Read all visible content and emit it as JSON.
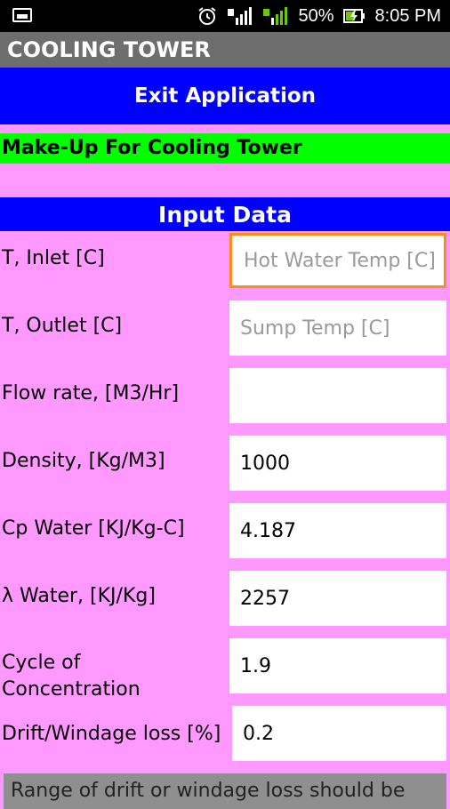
{
  "status_bar": {
    "battery": "50%",
    "time": "8:05 PM",
    "icons": [
      "image-icon",
      "alarm-icon",
      "signal-icon",
      "signal-icon",
      "battery-charging-icon"
    ]
  },
  "app": {
    "title": "COOLING TOWER"
  },
  "exit_button": {
    "label": "Exit Application"
  },
  "subtitle": "Make-Up For Cooling Tower",
  "section": {
    "title": "Input Data"
  },
  "fields": [
    {
      "label": "T, Inlet [C]",
      "value": "",
      "placeholder": "Hot Water Temp [C]"
    },
    {
      "label": "T, Outlet [C]",
      "value": "",
      "placeholder": "Sump Temp [C]"
    },
    {
      "label": "Flow rate, [M3/Hr]",
      "value": "",
      "placeholder": ""
    },
    {
      "label": "Density, [Kg/M3]",
      "value": "1000",
      "placeholder": ""
    },
    {
      "label": "Cp Water [KJ/Kg-C]",
      "value": "4.187",
      "placeholder": ""
    },
    {
      "label": " λ Water, [KJ/Kg]",
      "value": "2257",
      "placeholder": ""
    },
    {
      "label_line1": "Cycle of",
      "label_line2": "Concentration",
      "value": "1.9",
      "placeholder": ""
    },
    {
      "label": " Drift/Windage loss [%]",
      "value": "0.2",
      "placeholder": ""
    }
  ],
  "note": "Range of drift or windage loss should be",
  "colors": {
    "background": "#ff99ff",
    "titlebar": "#6e6e6e",
    "exit_button": "#0000ff",
    "subtitle_strip": "#00ff00",
    "section_header": "#0000ff",
    "focus_border": "#ff8c1a"
  }
}
